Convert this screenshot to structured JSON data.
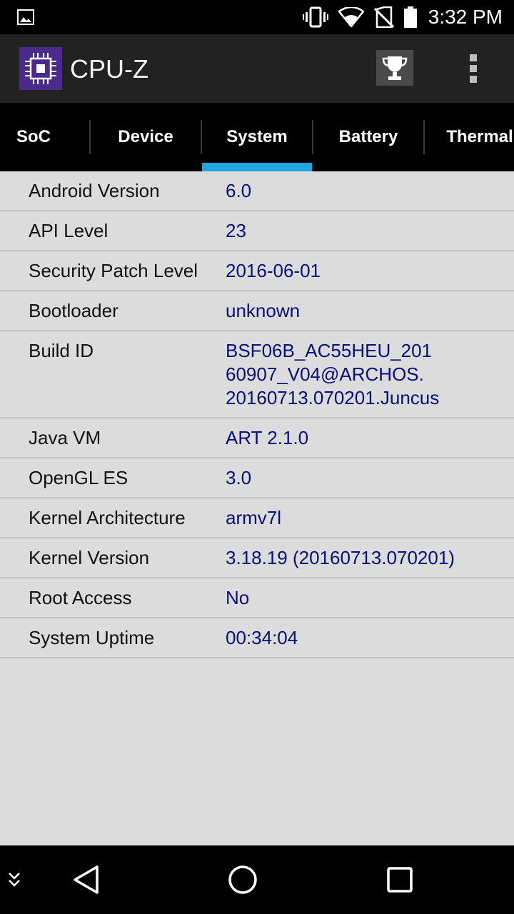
{
  "status_bar": {
    "time": "3:32 PM",
    "icons": [
      "gallery-icon",
      "vibrate-icon",
      "wifi-icon",
      "no-sim-icon",
      "battery-icon"
    ]
  },
  "app_bar": {
    "title": "CPU-Z",
    "logo_icon": "cpu-chip-icon",
    "actions": [
      "trophy-icon",
      "overflow-menu-icon"
    ],
    "accent_color": "#4a2a8c"
  },
  "tabs": [
    {
      "label": "SoC"
    },
    {
      "label": "Device"
    },
    {
      "label": "System",
      "selected": true
    },
    {
      "label": "Battery"
    },
    {
      "label": "Thermal"
    }
  ],
  "tab_indicator_color": "#1ea6e0",
  "system_info": [
    {
      "label": "Android Version",
      "value": "6.0"
    },
    {
      "label": "API Level",
      "value": "23"
    },
    {
      "label": "Security Patch Level",
      "value": "2016-06-01"
    },
    {
      "label": "Bootloader",
      "value": "unknown"
    },
    {
      "label": "Build ID",
      "value": "BSF06B_AC55HEU_201\n60907_V04@ARCHOS.\n20160713.070201.Juncus"
    },
    {
      "label": "Java VM",
      "value": "ART 2.1.0"
    },
    {
      "label": "OpenGL ES",
      "value": "3.0"
    },
    {
      "label": "Kernel Architecture",
      "value": "armv7l"
    },
    {
      "label": "Kernel Version",
      "value": "3.18.19 (20160713.070201)"
    },
    {
      "label": "Root Access",
      "value": "No"
    },
    {
      "label": "System Uptime",
      "value": "00:34:04"
    }
  ],
  "value_color": "#0d0d7a",
  "nav_bar": {
    "icons": [
      "collapse-icon",
      "back-icon",
      "home-icon",
      "recents-icon"
    ]
  }
}
